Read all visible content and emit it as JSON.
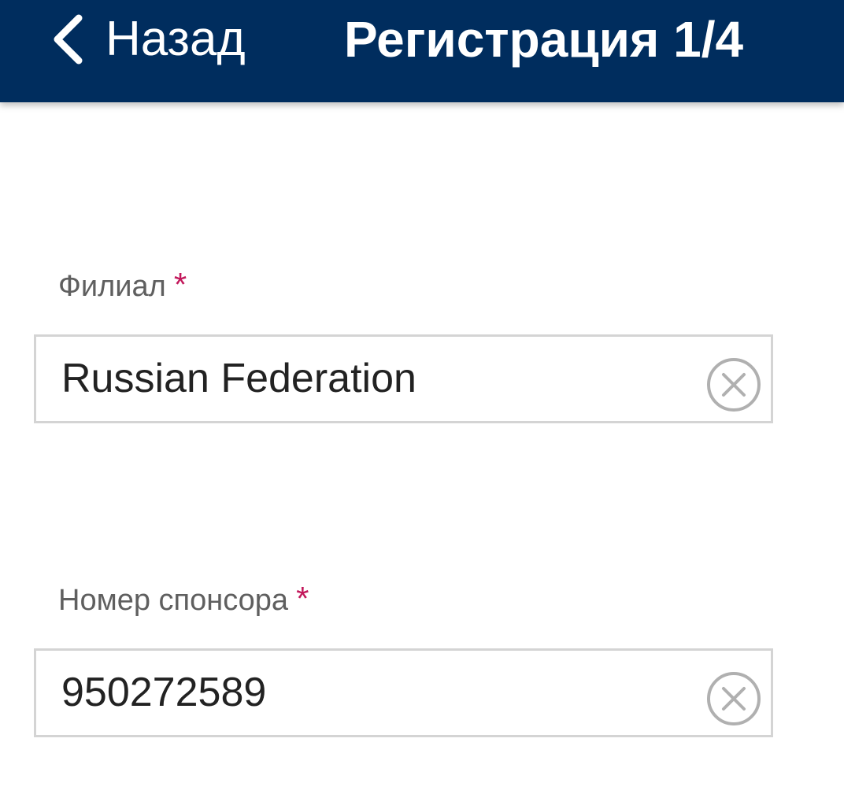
{
  "header": {
    "back_label": "Назад",
    "title": "Регистрация 1/4",
    "background": "#002d5e"
  },
  "form": {
    "branch": {
      "label": "Филиал",
      "required_mark": "*",
      "value": "Russian Federation"
    },
    "sponsor": {
      "label": "Номер спонсора",
      "required_mark": "*",
      "value": "950272589"
    }
  },
  "colors": {
    "required": "#c2185b",
    "label": "#5f5f5f",
    "border": "#d4d4d4"
  },
  "icons": {
    "back": "chevron-left-icon",
    "clear": "clear-circle-icon"
  }
}
